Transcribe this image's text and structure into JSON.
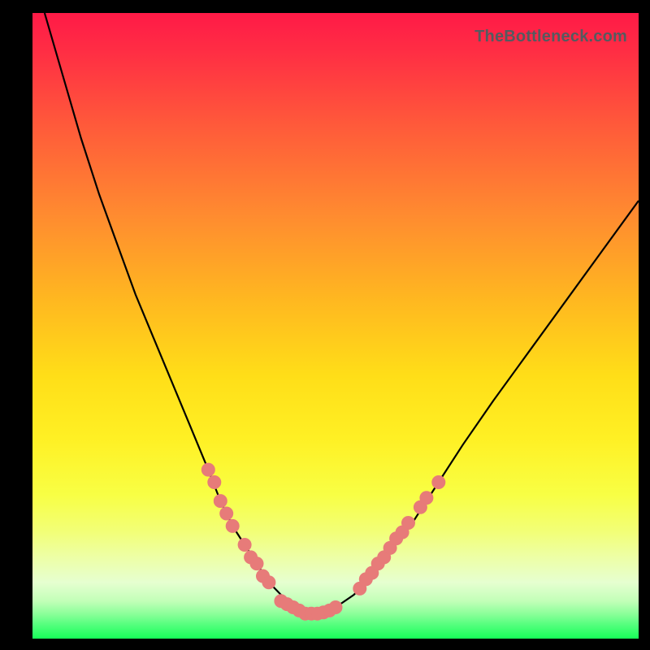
{
  "watermark": "TheBottleneck.com",
  "colors": {
    "background": "#000000",
    "curve": "#000000",
    "marker": "#e77b79"
  },
  "chart_data": {
    "type": "line",
    "title": "",
    "xlabel": "",
    "ylabel": "",
    "xlim": [
      0,
      100
    ],
    "ylim": [
      0,
      100
    ],
    "grid": false,
    "series": [
      {
        "name": "bottleneck-curve",
        "x": [
          2,
          5,
          8,
          11,
          14,
          17,
          20,
          23,
          26,
          29,
          31,
          33,
          35,
          37,
          39,
          41,
          43,
          45,
          47,
          50,
          53,
          56,
          59,
          63,
          67,
          71,
          76,
          82,
          88,
          94,
          100
        ],
        "y": [
          100,
          90,
          80,
          71,
          63,
          55,
          48,
          41,
          34,
          27,
          22,
          18,
          15,
          12,
          9,
          7,
          5,
          4,
          4,
          5,
          7,
          10,
          14,
          19,
          25,
          31,
          38,
          46,
          54,
          62,
          70
        ]
      }
    ],
    "markers": {
      "name": "highlighted-points",
      "points": [
        {
          "x": 29,
          "y": 27
        },
        {
          "x": 30,
          "y": 25
        },
        {
          "x": 31,
          "y": 22
        },
        {
          "x": 32,
          "y": 20
        },
        {
          "x": 33,
          "y": 18
        },
        {
          "x": 35,
          "y": 15
        },
        {
          "x": 36,
          "y": 13
        },
        {
          "x": 37,
          "y": 12
        },
        {
          "x": 38,
          "y": 10
        },
        {
          "x": 39,
          "y": 9
        },
        {
          "x": 41,
          "y": 6
        },
        {
          "x": 42,
          "y": 5.5
        },
        {
          "x": 43,
          "y": 5
        },
        {
          "x": 44,
          "y": 4.5
        },
        {
          "x": 45,
          "y": 4
        },
        {
          "x": 46,
          "y": 4
        },
        {
          "x": 47,
          "y": 4
        },
        {
          "x": 48,
          "y": 4.2
        },
        {
          "x": 49,
          "y": 4.5
        },
        {
          "x": 50,
          "y": 5
        },
        {
          "x": 54,
          "y": 8
        },
        {
          "x": 55,
          "y": 9.5
        },
        {
          "x": 56,
          "y": 10.5
        },
        {
          "x": 57,
          "y": 12
        },
        {
          "x": 58,
          "y": 13
        },
        {
          "x": 59,
          "y": 14.5
        },
        {
          "x": 60,
          "y": 16
        },
        {
          "x": 61,
          "y": 17
        },
        {
          "x": 62,
          "y": 18.5
        },
        {
          "x": 64,
          "y": 21
        },
        {
          "x": 65,
          "y": 22.5
        },
        {
          "x": 67,
          "y": 25
        }
      ]
    }
  }
}
